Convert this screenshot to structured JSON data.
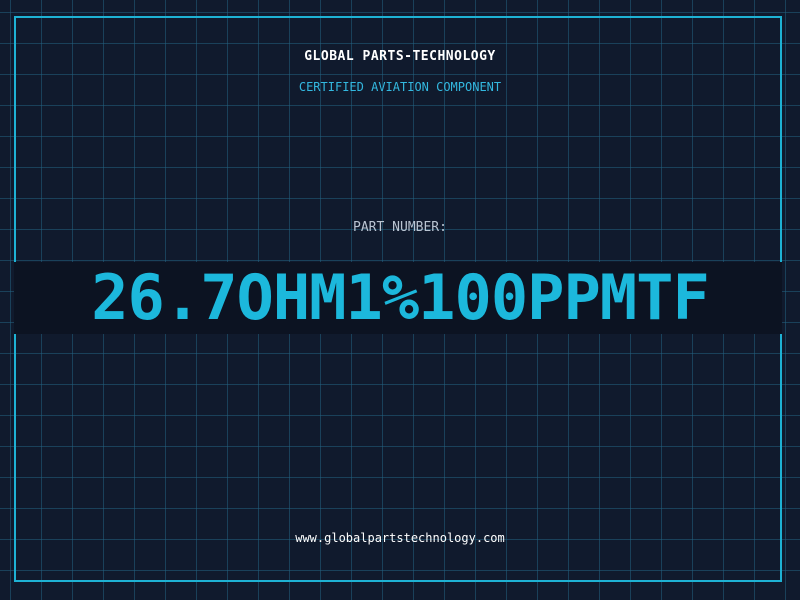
{
  "header": {
    "company": "GLOBAL PARTS-TECHNOLOGY",
    "tagline": "CERTIFIED AVIATION COMPONENT"
  },
  "part": {
    "label": "PART NUMBER:",
    "number": "26.7OHM1%100PPMTF"
  },
  "footer": {
    "website": "www.globalpartstechnology.com"
  },
  "colors": {
    "background": "#101a2d",
    "grid": "#236080",
    "accent": "#1cb8dc",
    "text": "#ffffff"
  }
}
